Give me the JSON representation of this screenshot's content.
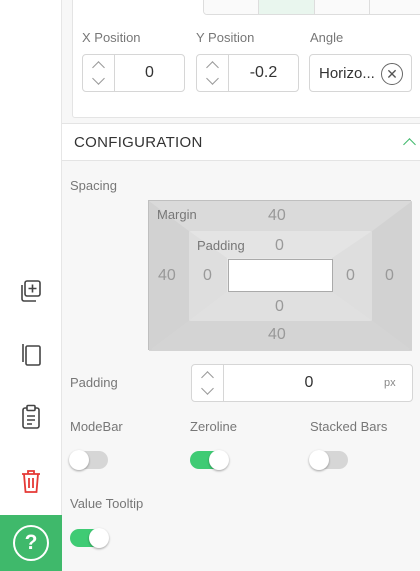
{
  "colors": {
    "accent": "#3fb96b",
    "toggle_on": "#3fcb74",
    "danger": "#e53935"
  },
  "toolbar": {
    "icons": [
      "add-to-group-icon",
      "copy-icon",
      "clipboard-icon",
      "trash-icon"
    ],
    "help_label": "?"
  },
  "position": {
    "x_label": "X Position",
    "x_value": "0",
    "y_label": "Y Position",
    "y_value": "-0.2",
    "angle_label": "Angle",
    "angle_value": "Horizo..."
  },
  "configuration": {
    "title": "CONFIGURATION",
    "spacing_label": "Spacing",
    "margin": {
      "label": "Margin",
      "top": "40",
      "bottom": "40",
      "left": "40",
      "right": "0"
    },
    "padding_box": {
      "label": "Padding",
      "top": "0",
      "bottom": "0",
      "left": "0",
      "right": "0"
    },
    "padding": {
      "label": "Padding",
      "value": "0",
      "unit": "px"
    },
    "modebar": {
      "label": "ModeBar",
      "on": false
    },
    "zeroline": {
      "label": "Zeroline",
      "on": true
    },
    "stacked_bars": {
      "label": "Stacked Bars",
      "on": false
    },
    "value_tooltip": {
      "label": "Value Tooltip",
      "on": true
    }
  }
}
